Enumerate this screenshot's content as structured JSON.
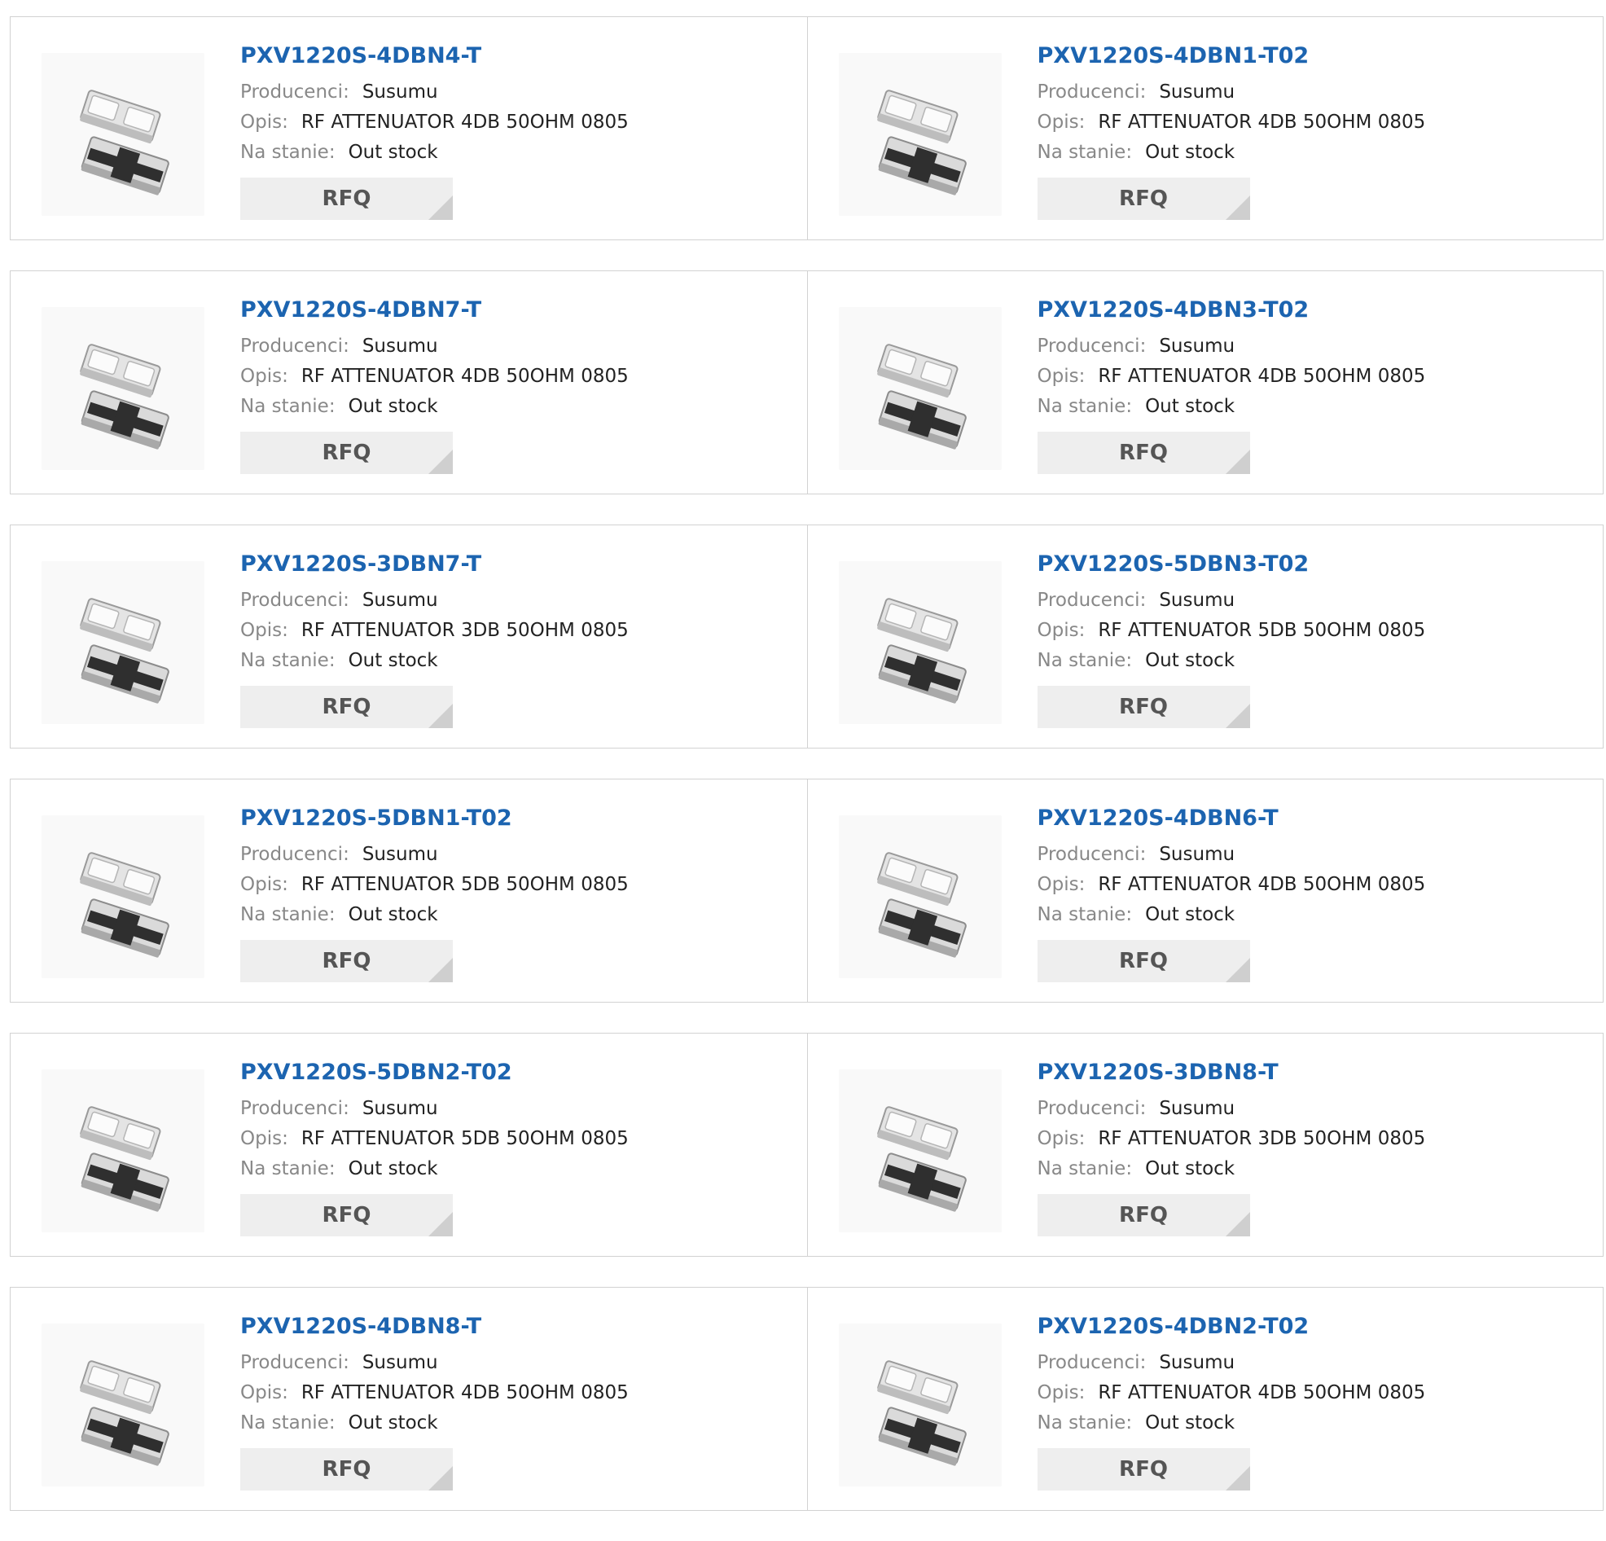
{
  "labels": {
    "manufacturer": "Producenci:",
    "description": "Opis:",
    "stock": "Na stanie:",
    "rfq": "RFQ"
  },
  "colors": {
    "title_link": "#1c64b0",
    "label_gray": "#888888",
    "value_dark": "#222222",
    "button_bg": "#eeeeee",
    "button_corner": "#cfcfcf",
    "border": "#d2d2d2"
  },
  "rows": [
    [
      {
        "part": "PXV1220S-4DBN4-T",
        "manufacturer": "Susumu",
        "description": "RF ATTENUATOR 4DB 50OHM 0805",
        "stock": "Out stock",
        "image_icon": "rf-attenuator-chip-image"
      },
      {
        "part": "PXV1220S-4DBN1-T02",
        "manufacturer": "Susumu",
        "description": "RF ATTENUATOR 4DB 50OHM 0805",
        "stock": "Out stock",
        "image_icon": "rf-attenuator-chip-image"
      }
    ],
    [
      {
        "part": "PXV1220S-4DBN7-T",
        "manufacturer": "Susumu",
        "description": "RF ATTENUATOR 4DB 50OHM 0805",
        "stock": "Out stock",
        "image_icon": "rf-attenuator-chip-image"
      },
      {
        "part": "PXV1220S-4DBN3-T02",
        "manufacturer": "Susumu",
        "description": "RF ATTENUATOR 4DB 50OHM 0805",
        "stock": "Out stock",
        "image_icon": "rf-attenuator-chip-image"
      }
    ],
    [
      {
        "part": "PXV1220S-3DBN7-T",
        "manufacturer": "Susumu",
        "description": "RF ATTENUATOR 3DB 50OHM 0805",
        "stock": "Out stock",
        "image_icon": "rf-attenuator-chip-image"
      },
      {
        "part": "PXV1220S-5DBN3-T02",
        "manufacturer": "Susumu",
        "description": "RF ATTENUATOR 5DB 50OHM 0805",
        "stock": "Out stock",
        "image_icon": "rf-attenuator-chip-image"
      }
    ],
    [
      {
        "part": "PXV1220S-5DBN1-T02",
        "manufacturer": "Susumu",
        "description": "RF ATTENUATOR 5DB 50OHM 0805",
        "stock": "Out stock",
        "image_icon": "rf-attenuator-chip-image"
      },
      {
        "part": "PXV1220S-4DBN6-T",
        "manufacturer": "Susumu",
        "description": "RF ATTENUATOR 4DB 50OHM 0805",
        "stock": "Out stock",
        "image_icon": "rf-attenuator-chip-image"
      }
    ],
    [
      {
        "part": "PXV1220S-5DBN2-T02",
        "manufacturer": "Susumu",
        "description": "RF ATTENUATOR 5DB 50OHM 0805",
        "stock": "Out stock",
        "image_icon": "rf-attenuator-chip-image"
      },
      {
        "part": "PXV1220S-3DBN8-T",
        "manufacturer": "Susumu",
        "description": "RF ATTENUATOR 3DB 50OHM 0805",
        "stock": "Out stock",
        "image_icon": "rf-attenuator-chip-image"
      }
    ],
    [
      {
        "part": "PXV1220S-4DBN8-T",
        "manufacturer": "Susumu",
        "description": "RF ATTENUATOR 4DB 50OHM 0805",
        "stock": "Out stock",
        "image_icon": "rf-attenuator-chip-image"
      },
      {
        "part": "PXV1220S-4DBN2-T02",
        "manufacturer": "Susumu",
        "description": "RF ATTENUATOR 4DB 50OHM 0805",
        "stock": "Out stock",
        "image_icon": "rf-attenuator-chip-image"
      }
    ]
  ]
}
